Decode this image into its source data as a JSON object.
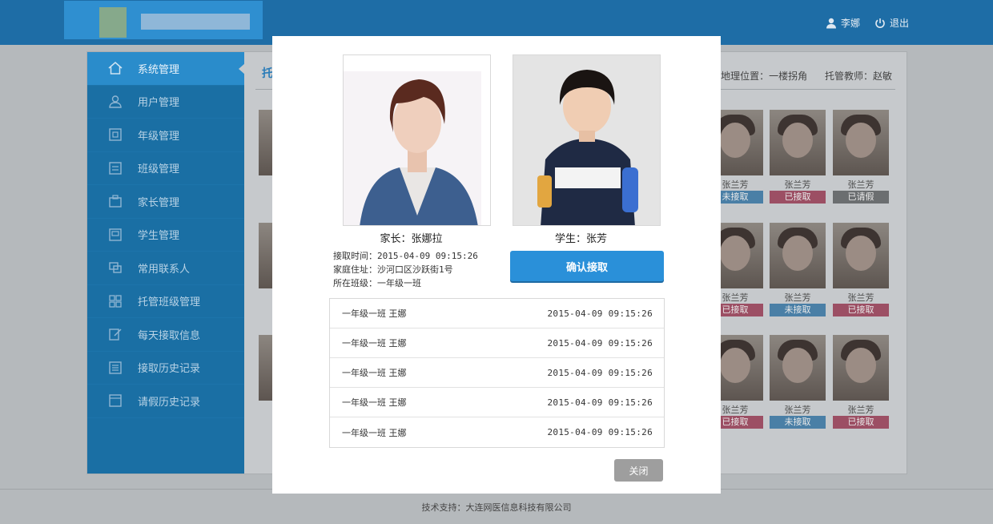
{
  "header": {
    "user_name": "李娜",
    "logout_label": "退出"
  },
  "sidebar": {
    "items": [
      {
        "label": "系统管理",
        "icon": "home-icon"
      },
      {
        "label": "用户管理",
        "icon": "user-icon"
      },
      {
        "label": "年级管理",
        "icon": "grade-icon"
      },
      {
        "label": "班级管理",
        "icon": "class-icon"
      },
      {
        "label": "家长管理",
        "icon": "parent-icon"
      },
      {
        "label": "学生管理",
        "icon": "student-icon"
      },
      {
        "label": "常用联系人",
        "icon": "contacts-icon"
      },
      {
        "label": "托管班级管理",
        "icon": "grid-icon"
      },
      {
        "label": "每天接取信息",
        "icon": "edit-icon"
      },
      {
        "label": "接取历史记录",
        "icon": "list-icon"
      },
      {
        "label": "请假历史记录",
        "icon": "leave-icon"
      }
    ]
  },
  "content": {
    "title_partial": "托",
    "location": "地理位置：一楼拐角",
    "teacher": "托管教师：赵敏"
  },
  "cards": [
    {
      "name": "张兰芳",
      "status": "未接取",
      "status_color": "blue"
    },
    {
      "name": "张兰芳",
      "status": "已接取",
      "status_color": "red"
    },
    {
      "name": "张兰芳",
      "status": "已请假",
      "status_color": "gray"
    },
    {
      "name": "张兰芳",
      "status": "已接取",
      "status_color": "red"
    },
    {
      "name": "张兰芳",
      "status": "未接取",
      "status_color": "blue"
    },
    {
      "name": "张兰芳",
      "status": "已接取",
      "status_color": "red"
    },
    {
      "name": "张兰芳",
      "status": "已接取",
      "status_color": "red"
    },
    {
      "name": "张兰芳",
      "status": "未接取",
      "status_color": "blue"
    },
    {
      "name": "张兰芳",
      "status": "已接取",
      "status_color": "red"
    }
  ],
  "modal": {
    "parent_caption": "家长：张娜拉",
    "student_caption": "学生：张芳",
    "pickup_time": "接取时间：2015-04-09   09:15:26",
    "address": "家庭住址：沙河口区沙跃街1号",
    "class_name": "所在班级：一年级一班",
    "confirm_label": "确认接取",
    "close_label": "关闭",
    "records": [
      {
        "who": "一年级一班  王娜",
        "time": "2015-04-09   09:15:26"
      },
      {
        "who": "一年级一班  王娜",
        "time": "2015-04-09   09:15:26"
      },
      {
        "who": "一年级一班  王娜",
        "time": "2015-04-09   09:15:26"
      },
      {
        "who": "一年级一班  王娜",
        "time": "2015-04-09   09:15:26"
      },
      {
        "who": "一年级一班  王娜",
        "time": "2015-04-09   09:15:26"
      }
    ]
  },
  "footer": {
    "text": "技术支持：大连网医信息科技有限公司"
  },
  "colors": {
    "header_bg": "#1e6da6",
    "sidebar_bg": "#1a6fa4",
    "confirm_button": "#2a90d9",
    "status_red": "#e0587e",
    "status_blue": "#3a8fcf",
    "status_gray": "#8d8d8d"
  }
}
